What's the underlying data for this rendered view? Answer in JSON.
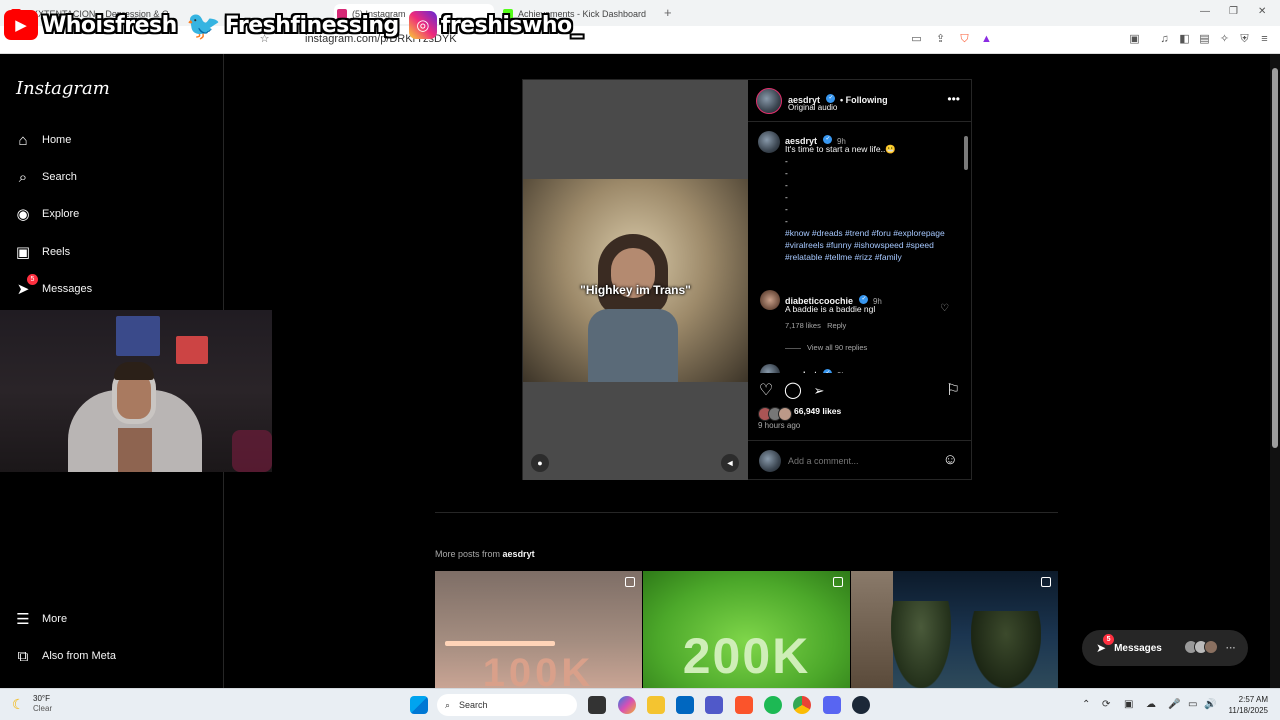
{
  "browser": {
    "tabs": [
      {
        "label": "XXXTENTACION – Depression & Ob"
      },
      {
        "label": "(5) Instagram"
      },
      {
        "label": "Achievements - Kick Dashboard"
      }
    ],
    "new_tab": "+",
    "url": "instagram.com/p/DRKrTzsDYK"
  },
  "overlay": {
    "youtube": "Whoisfresh",
    "twitter": "Freshfinessing",
    "instagram": "freshiswho_"
  },
  "sidebar": {
    "logo": "Instagram",
    "items": [
      {
        "label": "Home",
        "icon": "home-icon"
      },
      {
        "label": "Search",
        "icon": "search-icon"
      },
      {
        "label": "Explore",
        "icon": "explore-icon"
      },
      {
        "label": "Reels",
        "icon": "reels-icon"
      },
      {
        "label": "Messages",
        "icon": "messages-icon",
        "badge": "5"
      }
    ],
    "bottom": [
      {
        "label": "More",
        "icon": "menu-icon"
      },
      {
        "label": "Also from Meta",
        "icon": "meta-icon"
      }
    ]
  },
  "post": {
    "overlay_caption": "\"Highkey im Trans\"",
    "author": "aesdryt",
    "following": "• Following",
    "audio": "Original audio",
    "caption": {
      "user": "aesdryt",
      "time": "9h",
      "text": "It's time to start a new life..😬",
      "dashes": [
        "-",
        "-",
        "-",
        "-",
        "-",
        "-"
      ],
      "hashtags": "#know #dreads #trend #foru #explorepage #viralreels #funny #ishowspeed #speed #relatable #tellme #rizz #family"
    },
    "comment": {
      "user": "diabeticcoochie",
      "time": "9h",
      "text": "A baddie is a baddie ngl",
      "likes": "7,178 likes",
      "reply": "Reply",
      "view_replies": "View all 90 replies"
    },
    "next_comment": {
      "user": "aesdryt",
      "time": "9h"
    },
    "likes": "66,949 likes",
    "ago": "9 hours ago",
    "comment_placeholder": "Add a comment..."
  },
  "more_posts": {
    "label": "More posts from",
    "user": "aesdryt",
    "thumbs": [
      "100K",
      "200K",
      ""
    ]
  },
  "messages_pill": {
    "label": "Messages",
    "badge": "5"
  },
  "taskbar": {
    "temp": "30°F",
    "condition": "Clear",
    "search": "Search",
    "time": "2:57 AM",
    "date": "11/18/2025"
  }
}
